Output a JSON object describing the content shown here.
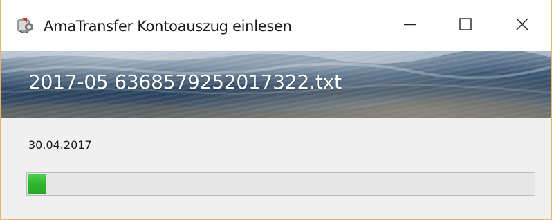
{
  "window": {
    "title": "AmaTransfer Kontoauszug einlesen",
    "app_icon": "amatransfer-app-icon",
    "controls": {
      "minimize_icon": "minimize-icon",
      "maximize_icon": "maximize-icon",
      "close_icon": "close-icon"
    }
  },
  "banner": {
    "title": "2017-05 6368579252017322.txt"
  },
  "status": {
    "date": "30.04.2017"
  },
  "progress": {
    "value_percent": 3.5,
    "color": "#2fb52f"
  }
}
